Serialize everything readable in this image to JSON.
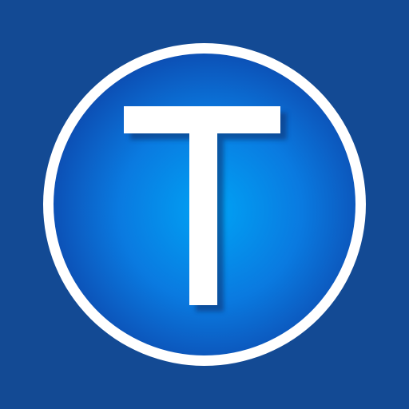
{
  "app_icon": {
    "name": "letter-t-app-icon",
    "letter": "T",
    "colors": {
      "background": "#134a94",
      "ring": "#ffffff",
      "disc_center": "#00a3f5",
      "disc_mid": "#0a7ae0",
      "disc_edge": "#0d4bb0",
      "letter": "#ffffff",
      "letter_shadow": "#0a2d6b"
    }
  }
}
